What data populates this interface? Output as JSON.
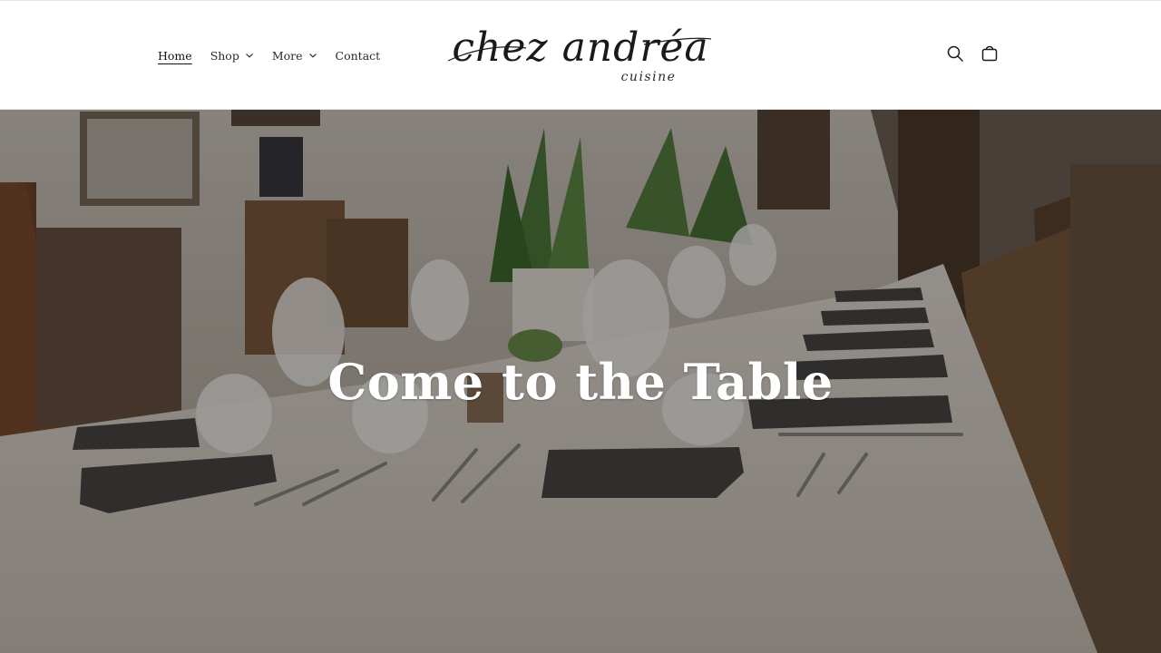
{
  "brand": {
    "logo_script": "chez andréa",
    "logo_subtitle": "cuisine"
  },
  "nav": {
    "items": [
      {
        "label": "Home",
        "active": true,
        "dropdown": false
      },
      {
        "label": "Shop",
        "active": false,
        "dropdown": true
      },
      {
        "label": "More",
        "active": false,
        "dropdown": true
      },
      {
        "label": "Contact",
        "active": false,
        "dropdown": false
      }
    ]
  },
  "header_icons": {
    "search": "search-icon",
    "cart": "cart-icon"
  },
  "hero": {
    "title": "Come to the Table",
    "overlay_color": "#000000",
    "overlay_opacity": 0.35
  },
  "colors": {
    "header_bg": "#ffffff",
    "text": "#121212",
    "hero_text": "#ffffff"
  }
}
